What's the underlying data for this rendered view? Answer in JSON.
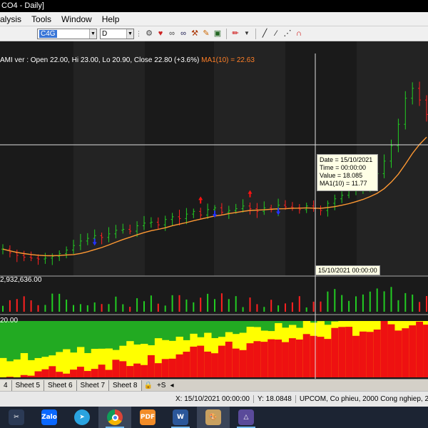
{
  "window": {
    "title": "CO4 - Daily]"
  },
  "menu": {
    "items": [
      "alysis",
      "Tools",
      "Window",
      "Help"
    ]
  },
  "toolbar": {
    "symbol": "C4G",
    "interval": "D"
  },
  "chart": {
    "info_text": "AMI ver : Open 22.00, Hi 23.00, Lo 20.90, Close 22.80 (+3.6%)",
    "ma_text": "MA1(10) = 22.63",
    "volume_text": "2,932,636.00",
    "osc_text": "20.00",
    "tooltip": {
      "date": "Date = 15/10/2021",
      "time": "Time = 00:00:00",
      "value": "Value = 18.085",
      "ma": "MA1(10) = 11.77"
    },
    "cursor_label": "15/10/2021 00:00:00",
    "colors": {
      "up": "#22cc22",
      "down": "#ff2020",
      "ma": "#ff9933",
      "osc_green": "#22aa22",
      "osc_yellow": "#ffff00",
      "osc_red": "#ee1111",
      "marker_up": "#2233ff",
      "marker_down": "#ff1111"
    }
  },
  "chart_data": {
    "type": "line",
    "series": [
      {
        "values": [
          11.0,
          10.6,
          10.3,
          10.1,
          10.0,
          9.9,
          10.0,
          10.2,
          10.5,
          10.9,
          11.4,
          11.9,
          12.2,
          12.5,
          12.3,
          12.7,
          13.1,
          13.2,
          13.0,
          13.6,
          13.9,
          14.0,
          13.7,
          14.3,
          14.6,
          14.4,
          14.9,
          15.2,
          14.8,
          15.4,
          15.6,
          15.1,
          15.3,
          15.5,
          15.8,
          15.5,
          15.2,
          15.6,
          15.4,
          15.9,
          15.7,
          15.6,
          15.4,
          15.8,
          15.5,
          15.3,
          16.1,
          16.6,
          17.0,
          17.6,
          17.9,
          18.1,
          18.6,
          19.4,
          20.8,
          22.5,
          24.9,
          27.8,
          28.9,
          27.6,
          26.0
        ]
      }
    ]
  },
  "tabs": {
    "items": [
      "4",
      "Sheet 5",
      "Sheet 6",
      "Sheet 7",
      "Sheet 8"
    ],
    "controls": "+S"
  },
  "status": {
    "x": "X: 15/10/2021 00:00:00",
    "y": "Y: 18.0848",
    "info": "UPCOM, Co phieu, 2000 Cong nghiep, 2350 Xay du"
  },
  "taskbar": {
    "apps": [
      {
        "name": "snipping-tool",
        "color": "#2b3a55",
        "label": ""
      },
      {
        "name": "zalo",
        "color": "#0a68ff",
        "label": "Zalo"
      },
      {
        "name": "telegram",
        "color": "#2aa3e0",
        "label": ""
      },
      {
        "name": "chrome",
        "color": "#db4437",
        "label": ""
      },
      {
        "name": "foxit-pdf",
        "color": "#f28c28",
        "label": "PDF"
      },
      {
        "name": "word",
        "color": "#2b579a",
        "label": "W"
      },
      {
        "name": "paint",
        "color": "#c8a060",
        "label": ""
      },
      {
        "name": "amibroker",
        "color": "#5a4a9a",
        "label": ""
      }
    ]
  }
}
